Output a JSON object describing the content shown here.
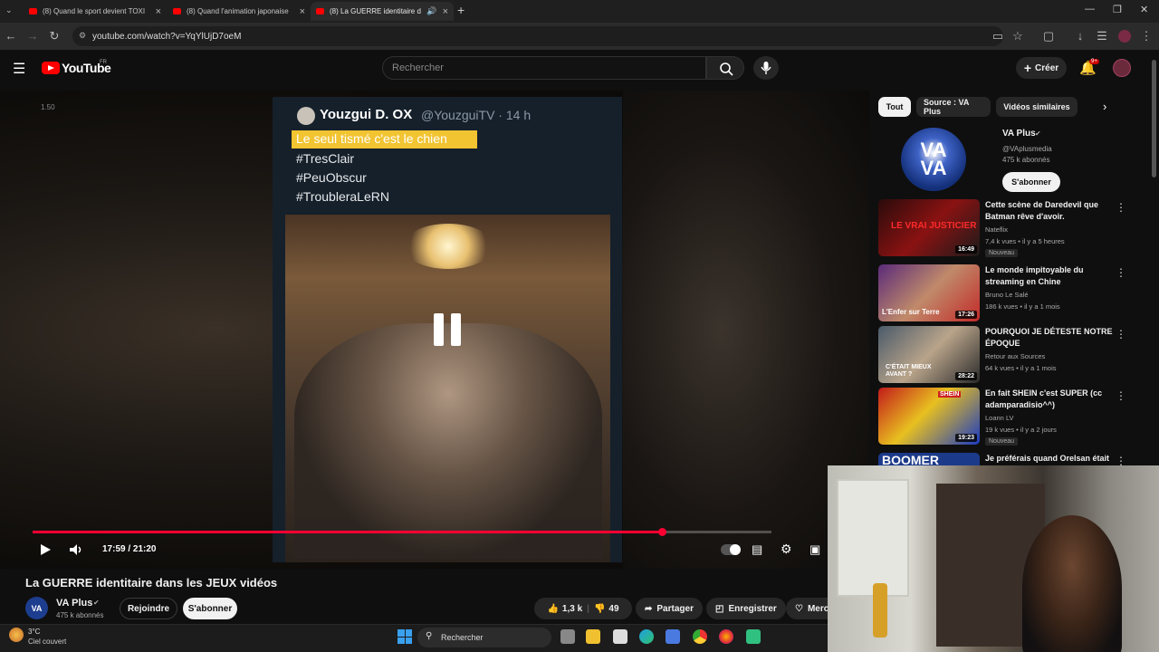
{
  "browser": {
    "tabs": [
      {
        "label": "(8) Quand le sport devient TOXI"
      },
      {
        "label": "(8) Quand l'animation japonaise"
      },
      {
        "label": "(8) La GUERRE identitaire d"
      }
    ],
    "url": "youtube.com/watch?v=YqYlUjD7oeM"
  },
  "header": {
    "logo": "YouTube",
    "region": "FR",
    "search_placeholder": "Rechercher",
    "create_label": "Créer",
    "notif_count": "9+"
  },
  "video": {
    "speed_label": "1.50",
    "tweet": {
      "name": "Youzgui D. OX",
      "handle_time": "@YouzguiTV · 14 h",
      "highlight": "Le seul tismé c'est le chien",
      "lines": [
        "#TresClair",
        "#PeuObscur",
        "#TroubleraLeRN"
      ]
    },
    "progress": 0.852,
    "time": "17:59 / 21:20",
    "title": "La GUERRE identitaire dans les JEUX vidéos",
    "channel": "VA Plus",
    "channel_subs": "475 k abonnés",
    "join_label": "Rejoindre",
    "subscribe_label": "S'abonner",
    "likes": "1,3 k",
    "dislikes": "49",
    "share_label": "Partager",
    "save_label": "Enregistrer",
    "more_label": "Merci"
  },
  "sidebar": {
    "chips": [
      "Tout",
      "Source : VA Plus",
      "Vidéos similaires"
    ],
    "channel_card": {
      "logo": "VA\nVA",
      "name": "VA Plus",
      "handle": "@VAplusmedia",
      "subs": "475 k abonnés",
      "subscribe_label": "S'abonner"
    },
    "recommendations": [
      {
        "title": "Cette scène de Daredevil que Batman rêve d'avoir.",
        "channel": "Nateflix",
        "meta": "7,4 k vues • il y a 5 heures",
        "badge": "Nouveau",
        "duration": "16:49",
        "thumb_text": "LE VRAI JUSTICIER"
      },
      {
        "title": "Le monde impitoyable du streaming en Chine",
        "channel": "Bruno Le Salé",
        "meta": "186 k vues • il y a 1 mois",
        "badge": "",
        "duration": "17:26",
        "thumb_text": "L'Enfer sur Terre"
      },
      {
        "title": "POURQUOI JE DÉTESTE NOTRE ÉPOQUE",
        "channel": "Retour aux Sources",
        "meta": "64 k vues • il y a 1 mois",
        "badge": "",
        "duration": "28:22",
        "thumb_text": "C'ÉTAIT MIEUX AVANT ?"
      },
      {
        "title": "En fait SHEIN c'est SUPER (cc adamparadisio^^)",
        "channel": "Loann LV",
        "meta": "19 k vues • il y a 2 jours",
        "badge": "Nouveau",
        "duration": "19:23",
        "thumb_text": "SHEIN"
      },
      {
        "title": "Je préférais quand Orelsan était",
        "channel": "",
        "meta": "",
        "badge": "",
        "duration": "",
        "thumb_text": "BOOMER"
      }
    ]
  },
  "taskbar": {
    "temp": "3°C",
    "weather": "Ciel couvert",
    "search_label": "Rechercher"
  }
}
